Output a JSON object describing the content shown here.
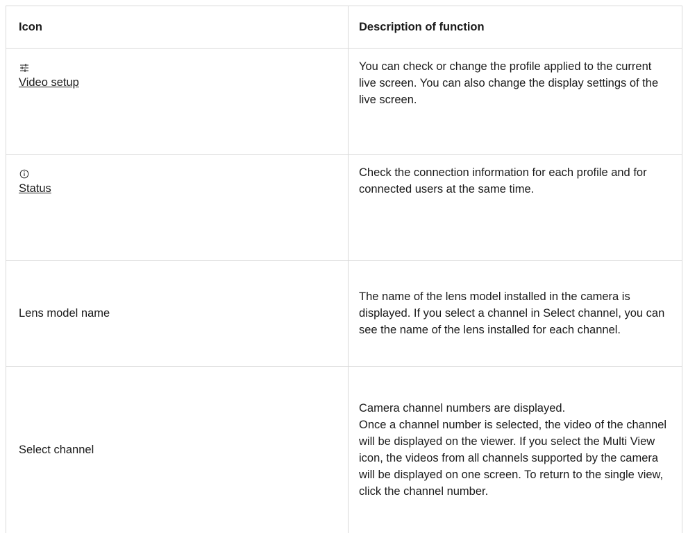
{
  "table": {
    "headers": {
      "icon": "Icon",
      "description": "Description of function"
    },
    "rows": [
      {
        "icon_name": "sliders-icon",
        "label": "Video setup",
        "description": "You can check or change the profile applied to the current live screen. You can also change the display settings of the live screen."
      },
      {
        "icon_name": "info-icon",
        "label": "Status",
        "description": "Check the connection information for each profile and for connected users at the same time."
      },
      {
        "label": "Lens model name",
        "description": "The name of the lens model installed in the camera is displayed. If you select a channel in Select channel, you can see the name of the lens installed for each channel."
      },
      {
        "label": "Select channel",
        "description_lines": [
          "Camera channel numbers are displayed.",
          "Once a channel number is selected, the video of the channel will be displayed on the viewer. If you select the Multi View icon, the videos from all channels supported by the camera will be displayed on one screen. To return to the single view, click the channel number."
        ]
      }
    ]
  }
}
